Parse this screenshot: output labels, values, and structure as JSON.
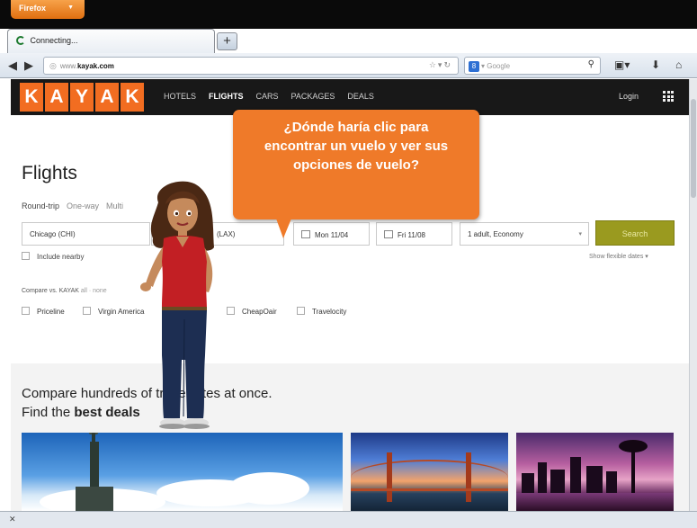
{
  "browser": {
    "menu_button": "Firefox",
    "tab_title": "Connecting...",
    "new_tab": "+",
    "url_prefix": "www.",
    "url_host": "kayak.com",
    "search_placeholder": "Google"
  },
  "header": {
    "logo_letters": [
      "K",
      "A",
      "Y",
      "A",
      "K"
    ],
    "nav": [
      "HOTELS",
      "FLIGHTS",
      "CARS",
      "PACKAGES",
      "DEALS"
    ],
    "login": "Login"
  },
  "search": {
    "title": "Flights",
    "trip_types": [
      "Round-trip",
      "One-way",
      "Multi"
    ],
    "origin": "Chicago (CHI)",
    "destination": "(LAX)",
    "depart": "Mon 11/04",
    "return": "Fri 11/08",
    "travelers": "1 adult, Economy",
    "search_button": "Search",
    "include_nearby": "Include nearby",
    "flexible_dates": "Show flexible dates ▾"
  },
  "compare": {
    "label": "Compare vs. KAYAK",
    "all_none": "all · none",
    "options": [
      "Priceline",
      "Virgin America",
      "CheapOair",
      "Travelocity"
    ]
  },
  "hero": {
    "line1": "Compare hundreds of travel sites at once.",
    "line2_prefix": "Find the ",
    "line2_bold": "best deals"
  },
  "callout": {
    "text": "¿Dónde haría clic para encontrar un vuelo y ver sus opciones de vuelo?"
  },
  "colors": {
    "kayak_orange": "#f26d21",
    "callout_orange": "#ef7a29",
    "search_olive": "#9a9a1f",
    "header_black": "#181818"
  }
}
